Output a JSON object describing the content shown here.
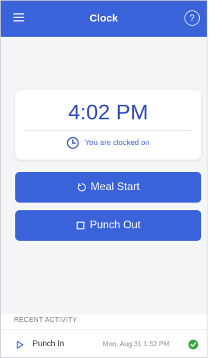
{
  "header": {
    "title": "Clock",
    "help_glyph": "?",
    "menu_icon": "hamburger-icon",
    "help_icon": "help-circle-icon"
  },
  "clock_card": {
    "time": "4:02 PM",
    "status": "You are clocked on",
    "status_icon": "clock-icon"
  },
  "actions": {
    "meal_start_label": "Meal Start",
    "meal_start_icon": "refresh-circle-icon",
    "punch_out_label": "Punch Out",
    "punch_out_icon": "square-icon"
  },
  "recent_activity": {
    "header": "RECENT ACTIVITY",
    "items": [
      {
        "label": "Punch In",
        "timestamp": "Mon, Aug 31 1:52 PM",
        "icon": "play-icon",
        "status_icon": "check-circle-icon"
      }
    ]
  },
  "colors": {
    "primary": "#3b63d9",
    "time_text": "#2f4bbf",
    "status_text": "#3f6ae0",
    "success": "#3aa745"
  }
}
